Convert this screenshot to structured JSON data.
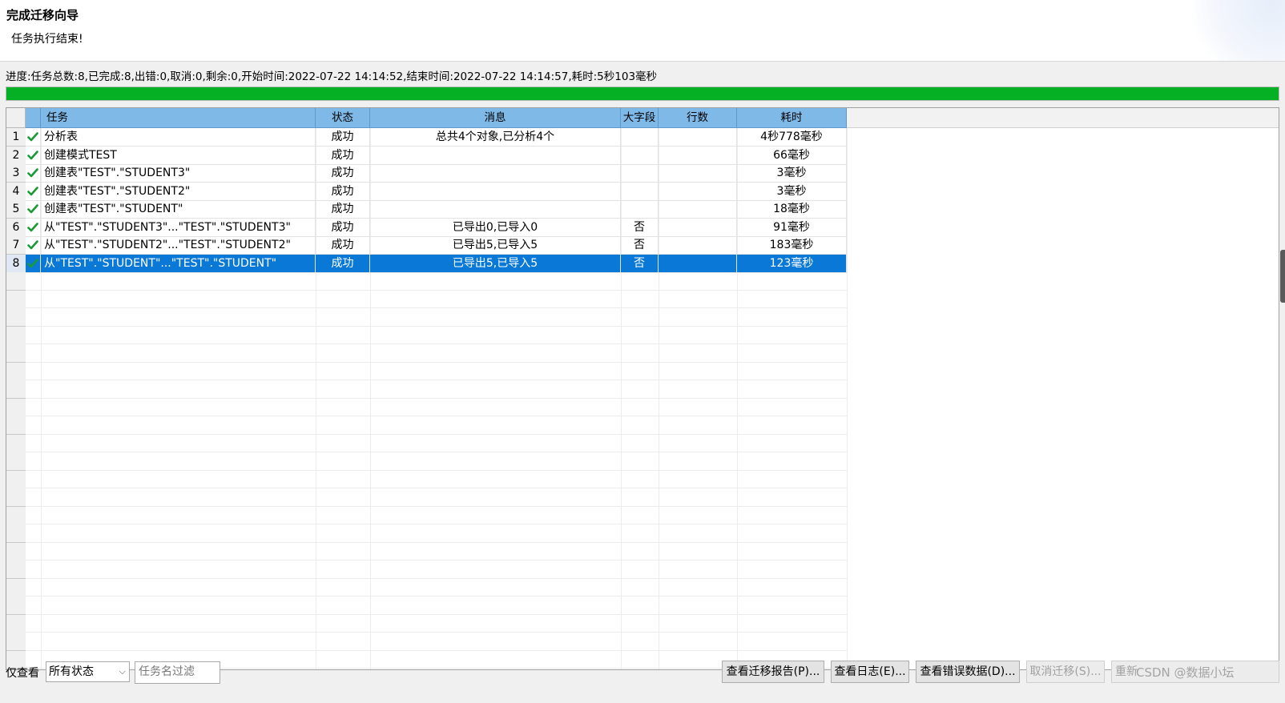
{
  "header": {
    "title": "完成迁移向导",
    "subtitle": "任务执行结束!"
  },
  "progress": {
    "text": "进度:任务总数:8,已完成:8,出错:0,取消:0,剩余:0,开始时间:2022-07-22 14:14:52,结束时间:2022-07-22 14:14:57,耗时:5秒103毫秒",
    "fraction": 1.0,
    "color": "#06b025"
  },
  "table": {
    "columns": {
      "task": "任务",
      "status": "状态",
      "message": "消息",
      "bigfield": "大字段",
      "rows": "行数",
      "time": "耗时"
    },
    "rows": [
      {
        "num": "1",
        "task": "分析表",
        "status": "成功",
        "message": "总共4个对象,已分析4个",
        "bigfield": "",
        "rows": "",
        "time": "4秒778毫秒"
      },
      {
        "num": "2",
        "task": "创建模式TEST",
        "status": "成功",
        "message": "",
        "bigfield": "",
        "rows": "",
        "time": "66毫秒"
      },
      {
        "num": "3",
        "task": "创建表\"TEST\".\"STUDENT3\"",
        "status": "成功",
        "message": "",
        "bigfield": "",
        "rows": "",
        "time": "3毫秒"
      },
      {
        "num": "4",
        "task": "创建表\"TEST\".\"STUDENT2\"",
        "status": "成功",
        "message": "",
        "bigfield": "",
        "rows": "",
        "time": "3毫秒"
      },
      {
        "num": "5",
        "task": "创建表\"TEST\".\"STUDENT\"",
        "status": "成功",
        "message": "",
        "bigfield": "",
        "rows": "",
        "time": "18毫秒"
      },
      {
        "num": "6",
        "task": "从\"TEST\".\"STUDENT3\"...\"TEST\".\"STUDENT3\"",
        "status": "成功",
        "message": "已导出0,已导入0",
        "bigfield": "否",
        "rows": "",
        "time": "91毫秒"
      },
      {
        "num": "7",
        "task": "从\"TEST\".\"STUDENT2\"...\"TEST\".\"STUDENT2\"",
        "status": "成功",
        "message": "已导出5,已导入5",
        "bigfield": "否",
        "rows": "",
        "time": "183毫秒"
      },
      {
        "num": "8",
        "task": "从\"TEST\".\"STUDENT\"...\"TEST\".\"STUDENT\"",
        "status": "成功",
        "message": "已导出5,已导入5",
        "bigfield": "否",
        "rows": "",
        "time": "123毫秒",
        "selected": true
      }
    ],
    "selection_color": "#0a78d7",
    "header_color": "#7fb9e8",
    "row_icon": "check-icon",
    "check_color": "#1a9a36"
  },
  "footer": {
    "filter_label": "仅查看",
    "status_filter": "所有状态",
    "task_filter_placeholder": "任务名过滤",
    "buttons": {
      "report": "查看迁移报告(P)...",
      "log": "查看日志(E)...",
      "errors": "查看错误数据(D)...",
      "cancel": "取消迁移(S)...",
      "restart": "重新"
    },
    "watermark": "CSDN @数据小坛"
  }
}
